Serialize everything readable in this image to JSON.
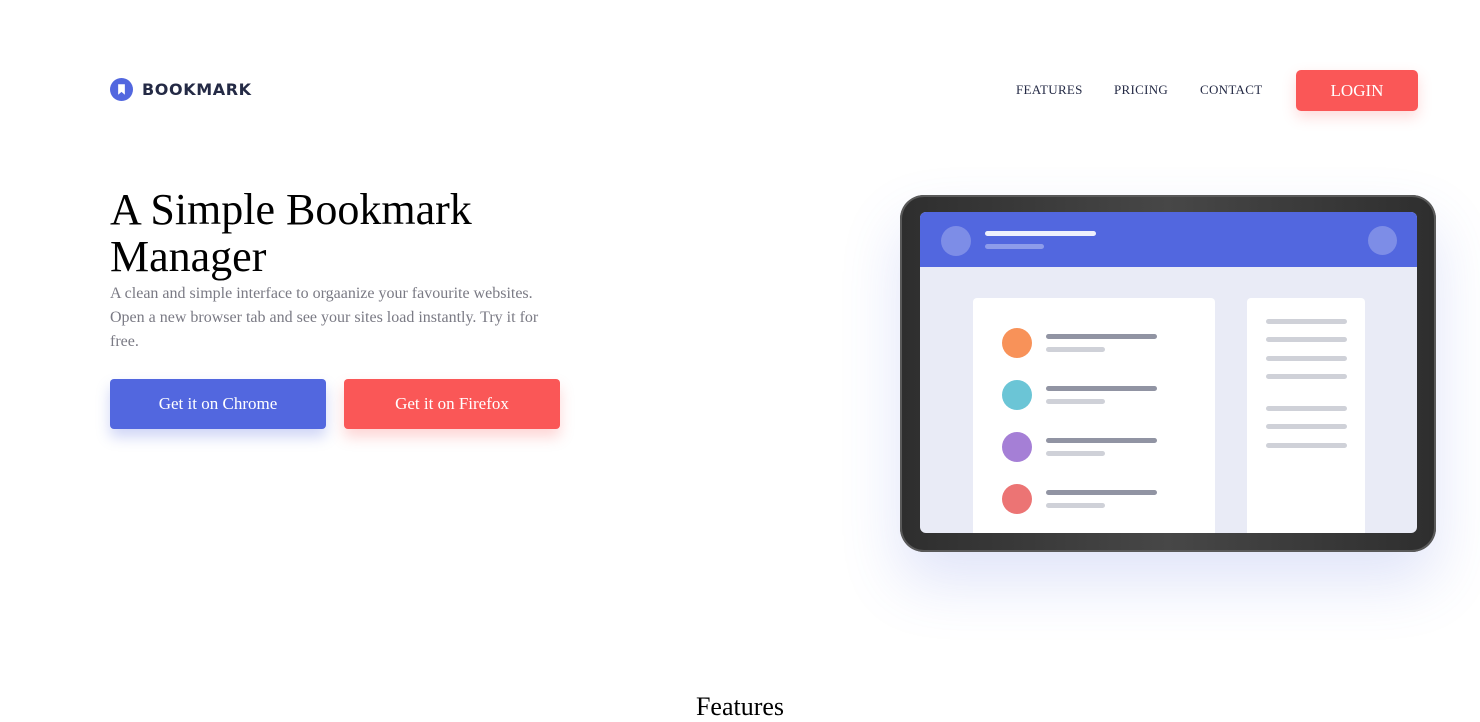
{
  "brand": {
    "name": "BOOKMARK",
    "color": "#5267df"
  },
  "nav": {
    "features": "FEATURES",
    "pricing": "PRICING",
    "contact": "CONTACT",
    "login": "LOGIN"
  },
  "hero": {
    "title": "A Simple Bookmark Manager",
    "description": "A clean and simple interface to orgaanize your favourite websites. Open a new browser tab and see your sites load instantly. Try it for free.",
    "chrome_button": "Get it on Chrome",
    "firefox_button": "Get it on Firefox"
  },
  "colors": {
    "primary": "#5267df",
    "accent": "#fa5757",
    "bookmark_dots": [
      "#f89259",
      "#6bc5d6",
      "#a57fd6",
      "#ec7474"
    ]
  },
  "features_section": {
    "title": "Features"
  }
}
